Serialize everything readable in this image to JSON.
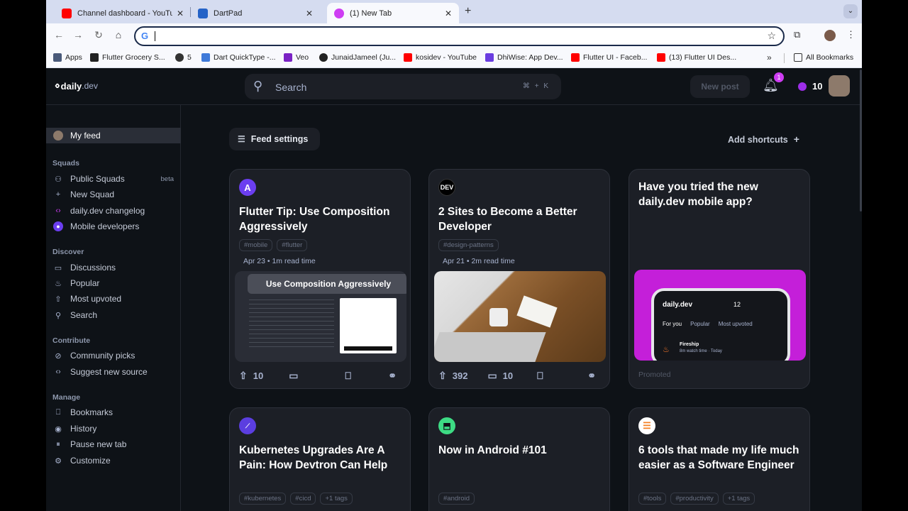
{
  "browser": {
    "tabs": [
      {
        "title": "Channel dashboard - YouTube",
        "color": "#ff0000"
      },
      {
        "title": "DartPad",
        "color": "#2563c7"
      },
      {
        "title": "(1) New Tab",
        "color": "#ce3df3"
      }
    ],
    "omnibox_value": "",
    "bookmarks": [
      {
        "label": "Apps",
        "color": "#4a5a7a"
      },
      {
        "label": "Flutter Grocery S...",
        "color": "#222222"
      },
      {
        "label": "5",
        "color": "#333333"
      },
      {
        "label": "Dart QuickType -...",
        "color": "#3f7ad9"
      },
      {
        "label": "Veo",
        "color": "#7a22c4"
      },
      {
        "label": "JunaidJameel (Ju...",
        "color": "#222222"
      },
      {
        "label": "kosidev - YouTube",
        "color": "#ff0000"
      },
      {
        "label": "DhiWise: App Dev...",
        "color": "#6a3de0"
      },
      {
        "label": "Flutter UI - Faceb...",
        "color": "#ff0000"
      },
      {
        "label": "(13) Flutter UI Des...",
        "color": "#ff0000"
      }
    ],
    "all_bookmarks": "All Bookmarks"
  },
  "header": {
    "logo_word1": "daily",
    "logo_word2": ".dev",
    "search_placeholder": "Search",
    "search_shortcut": "⌘ + K",
    "new_post": "New post",
    "notifications_count": "1",
    "reputation": "10"
  },
  "sidebar": {
    "my_feed": "My feed",
    "squads_heading": "Squads",
    "public_squads": "Public Squads",
    "beta": "beta",
    "new_squad": "New Squad",
    "changelog": "daily.dev changelog",
    "mobile_developers": "Mobile developers",
    "discover_heading": "Discover",
    "discussions": "Discussions",
    "popular": "Popular",
    "most_upvoted": "Most upvoted",
    "search": "Search",
    "contribute_heading": "Contribute",
    "community_picks": "Community picks",
    "suggest_source": "Suggest new source",
    "manage_heading": "Manage",
    "bookmarks": "Bookmarks",
    "history": "History",
    "pause_new_tab": "Pause new tab",
    "customize": "Customize"
  },
  "feed": {
    "feed_settings": "Feed settings",
    "add_shortcuts": "Add shortcuts",
    "cards": [
      {
        "source_label": "A",
        "source_color": "#6b3ef0",
        "title": "Flutter Tip: Use Composition Aggressively",
        "tags": [
          "#mobile",
          "#flutter"
        ],
        "meta": "Apr 23 • 1m read time",
        "banner": "Use Composition Aggressively",
        "upvotes": "10",
        "comments": ""
      },
      {
        "source_label": "DEV",
        "source_color": "#000000",
        "title": "2 Sites to Become a Better Developer",
        "tags": [
          "#design-patterns"
        ],
        "meta": "Apr 21 • 2m read time",
        "upvotes": "392",
        "comments": "10"
      },
      {
        "title": "Have you tried the new daily.dev mobile app?",
        "promoted": "Promoted",
        "mock": {
          "app": "daily.dev",
          "count": "12",
          "tabs": [
            "For you",
            "Popular",
            "Most upvoted"
          ],
          "item_title": "Fireship",
          "item_meta": "8m watch time · Today"
        }
      },
      {
        "source_color": "#5b3ee0",
        "title": "Kubernetes Upgrades Are A Pain: How Devtron Can Help",
        "tags": [
          "#kubernetes",
          "#cicd",
          "+1 tags"
        ]
      },
      {
        "source_color": "#3ddc84",
        "title": "Now in Android #101",
        "tags": [
          "#android"
        ]
      },
      {
        "source_color": "#f48024",
        "title": "6 tools that made my life much easier as a Software Engineer",
        "tags": [
          "#tools",
          "#productivity",
          "+1 tags"
        ]
      }
    ]
  }
}
